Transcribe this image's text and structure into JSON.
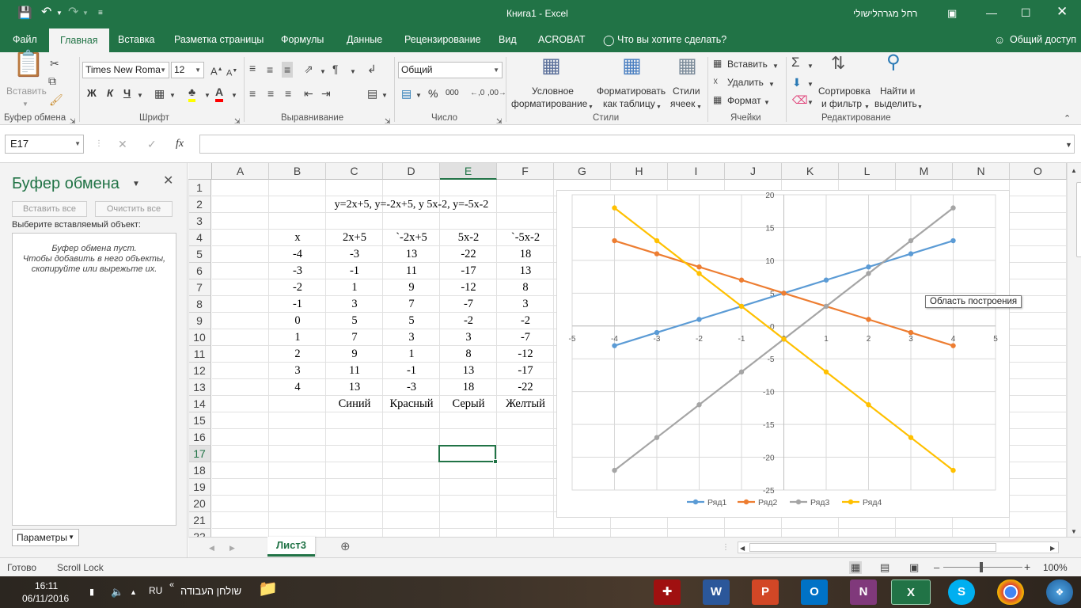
{
  "window": {
    "title": "Книга1  -  Excel",
    "user": "רחל מגרהלישולי"
  },
  "tabs": [
    {
      "label": "Файл"
    },
    {
      "label": "Главная"
    },
    {
      "label": "Вставка"
    },
    {
      "label": "Разметка страницы"
    },
    {
      "label": "Формулы"
    },
    {
      "label": "Данные"
    },
    {
      "label": "Рецензирование"
    },
    {
      "label": "Вид"
    },
    {
      "label": "ACROBAT"
    },
    {
      "label": "Что вы хотите сделать?"
    },
    {
      "label": "Общий доступ"
    }
  ],
  "ribbon": {
    "paste": "Вставить",
    "font_name": "Times New Roma",
    "font_size": "12",
    "bold": "Ж",
    "italic": "К",
    "underline": "Ч",
    "number_format": "Общий",
    "percent": "%",
    "thousands": "000",
    "cond_format_1": "Условное",
    "cond_format_2": "форматирование",
    "format_table_1": "Форматировать",
    "format_table_2": "как таблицу",
    "cell_styles_1": "Стили",
    "cell_styles_2": "ячеек",
    "insert": "Вставить",
    "delete": "Удалить",
    "format": "Формат",
    "sort_1": "Сортировка",
    "sort_2": "и фильтр",
    "find_1": "Найти и",
    "find_2": "выделить",
    "groups": [
      "Буфер обмена",
      "Шрифт",
      "Выравнивание",
      "Число",
      "Стили",
      "Ячейки",
      "Редактирование"
    ]
  },
  "formula_bar": {
    "name_box": "E17",
    "fx": "fx",
    "value": ""
  },
  "clipboard_pane": {
    "title": "Буфер обмена",
    "paste_all": "Вставить все",
    "clear_all": "Очистить все",
    "prompt": "Выберите вставляемый объект:",
    "empty_1": "Буфер обмена пуст.",
    "empty_2": "Чтобы добавить в него объекты,",
    "empty_3": "скопируйте или вырежьте их.",
    "options": "Параметры"
  },
  "columns": [
    "A",
    "B",
    "C",
    "D",
    "E",
    "F",
    "G",
    "H",
    "I",
    "J",
    "K",
    "L",
    "M",
    "N",
    "O"
  ],
  "rows": [
    "1",
    "2",
    "3",
    "4",
    "5",
    "6",
    "7",
    "8",
    "9",
    "10",
    "11",
    "12",
    "13",
    "14",
    "15",
    "16",
    "17",
    "18",
    "19",
    "20",
    "21",
    "22"
  ],
  "sheet": {
    "title_cell": "y=2x+5, y=-2x+5, y 5x-2, y=-5x-2",
    "headers": [
      "x",
      "2x+5",
      "`-2x+5",
      "5x-2",
      "`-5x-2"
    ],
    "table": [
      [
        "-4",
        "-3",
        "13",
        "-22",
        "18"
      ],
      [
        "-3",
        "-1",
        "11",
        "-17",
        "13"
      ],
      [
        "-2",
        "1",
        "9",
        "-12",
        "8"
      ],
      [
        "-1",
        "3",
        "7",
        "-7",
        "3"
      ],
      [
        "0",
        "5",
        "5",
        "-2",
        "-2"
      ],
      [
        "1",
        "7",
        "3",
        "3",
        "-7"
      ],
      [
        "2",
        "9",
        "1",
        "8",
        "-12"
      ],
      [
        "3",
        "11",
        "-1",
        "13",
        "-17"
      ],
      [
        "4",
        "13",
        "-3",
        "18",
        "-22"
      ]
    ],
    "colors_row": [
      "Синий",
      "Красный",
      "Серый",
      "Желтый"
    ]
  },
  "chart_data": {
    "type": "scatter",
    "title": "",
    "xlabel": "",
    "ylabel": "",
    "xlim": [
      -5,
      5
    ],
    "ylim": [
      -25,
      20
    ],
    "xticks": [
      "-5",
      "-4",
      "-3",
      "-2",
      "-1",
      "0",
      "1",
      "2",
      "3",
      "4",
      "5"
    ],
    "yticks": [
      "20",
      "15",
      "10",
      "5",
      "0",
      "-5",
      "-10",
      "-15",
      "-20",
      "-25"
    ],
    "grid": true,
    "legend": "bottom",
    "x": [
      -4,
      -3,
      -2,
      -1,
      0,
      1,
      2,
      3,
      4
    ],
    "series": [
      {
        "name": "Ряд1",
        "color": "#5b9bd5",
        "values": [
          -3,
          -1,
          1,
          3,
          5,
          7,
          9,
          11,
          13
        ]
      },
      {
        "name": "Ряд2",
        "color": "#ed7d31",
        "values": [
          13,
          11,
          9,
          7,
          5,
          3,
          1,
          -1,
          -3
        ]
      },
      {
        "name": "Ряд3",
        "color": "#a5a5a5",
        "values": [
          -22,
          -17,
          -12,
          -7,
          -2,
          3,
          8,
          13,
          18
        ]
      },
      {
        "name": "Ряд4",
        "color": "#ffc000",
        "values": [
          18,
          13,
          8,
          3,
          -2,
          -7,
          -12,
          -17,
          -22
        ]
      }
    ],
    "tooltip": "Область построения"
  },
  "sheet_tabs": [
    {
      "label": "Лист3"
    }
  ],
  "status": {
    "ready": "Готово",
    "scroll_lock": "Scroll Lock",
    "zoom": "100%"
  },
  "taskbar": {
    "time": "16:11",
    "date": "06/11/2016",
    "lang": "RU",
    "desktop": "שולחן העבודה"
  }
}
